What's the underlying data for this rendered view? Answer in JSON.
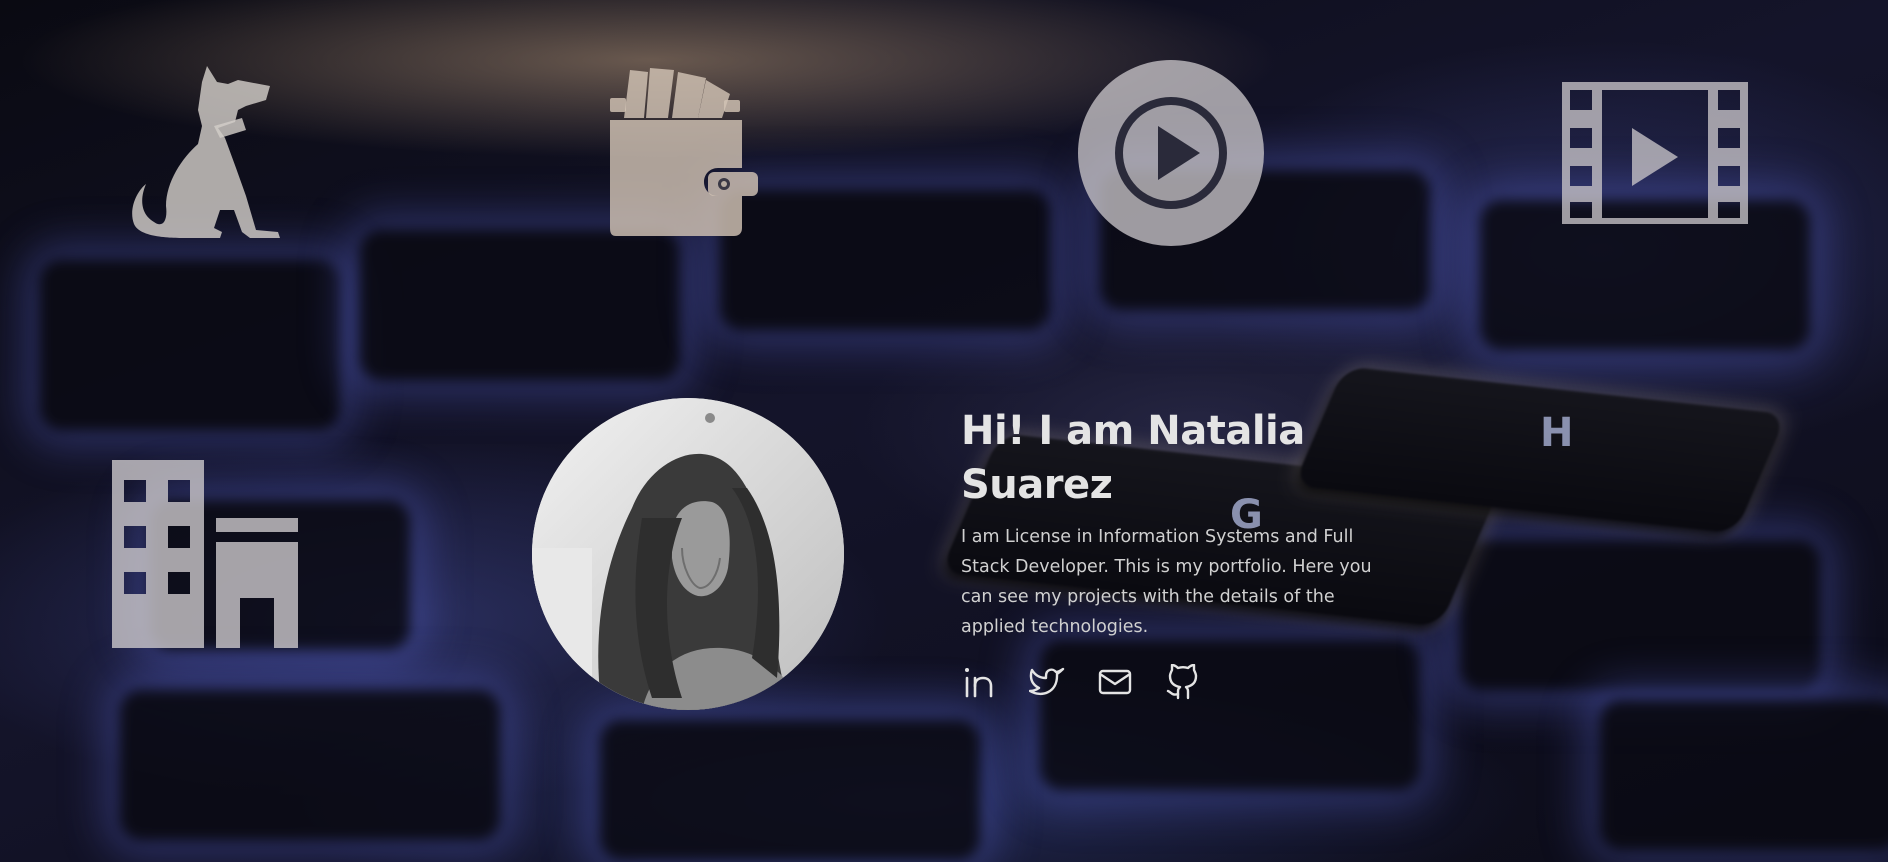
{
  "hero": {
    "greeting": "Hi! I am Natalia Suarez",
    "bio": "I am License in Information Systems and Full Stack Developer. This is my portfolio. Here you can see my projects with the details of the applied technologies."
  },
  "project_icons": [
    {
      "icon": "dog-icon"
    },
    {
      "icon": "wallet-icon"
    },
    {
      "icon": "play-circle-icon"
    },
    {
      "icon": "film-icon"
    },
    {
      "icon": "buildings-icon"
    }
  ],
  "socials": [
    {
      "icon": "linkedin-icon"
    },
    {
      "icon": "twitter-icon"
    },
    {
      "icon": "mail-icon"
    },
    {
      "icon": "github-icon"
    }
  ],
  "background": {
    "keys": [
      "G",
      "H"
    ]
  },
  "colors": {
    "icon_fill": "#c8c4c2",
    "text": "#e4e4e4",
    "background": "#0b0b14"
  }
}
